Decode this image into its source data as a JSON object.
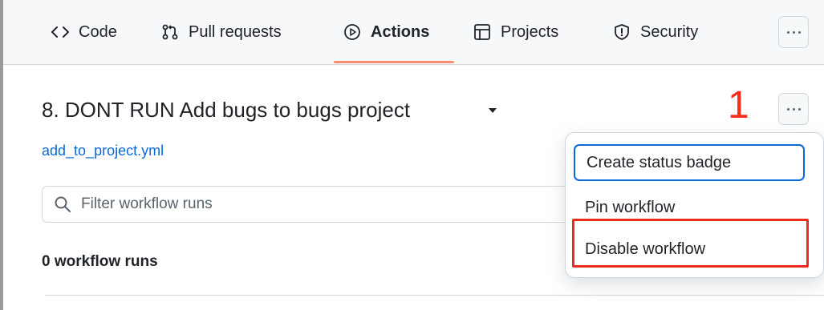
{
  "nav": {
    "tabs": [
      {
        "label": "Code",
        "icon": "code-icon"
      },
      {
        "label": "Pull requests",
        "icon": "git-pull-request-icon"
      },
      {
        "label": "Actions",
        "icon": "play-icon",
        "active": true
      },
      {
        "label": "Projects",
        "icon": "table-icon"
      },
      {
        "label": "Security",
        "icon": "shield-icon"
      }
    ]
  },
  "workflow": {
    "title": "8. DONT RUN Add bugs to bugs project",
    "file": "add_to_project.yml",
    "filter_placeholder": "Filter workflow runs",
    "runs_count": "0 workflow runs"
  },
  "annotation": {
    "step": "1",
    "color": "#ff2a1a"
  },
  "menu": {
    "items": [
      {
        "label": "Create status badge",
        "focused": true
      },
      {
        "label": "Pin workflow"
      },
      {
        "label": "Disable workflow",
        "highlighted": true
      }
    ]
  },
  "colors": {
    "link": "#0969da",
    "active_underline": "#fd8c73",
    "highlight_box": "#ee2a1d"
  }
}
